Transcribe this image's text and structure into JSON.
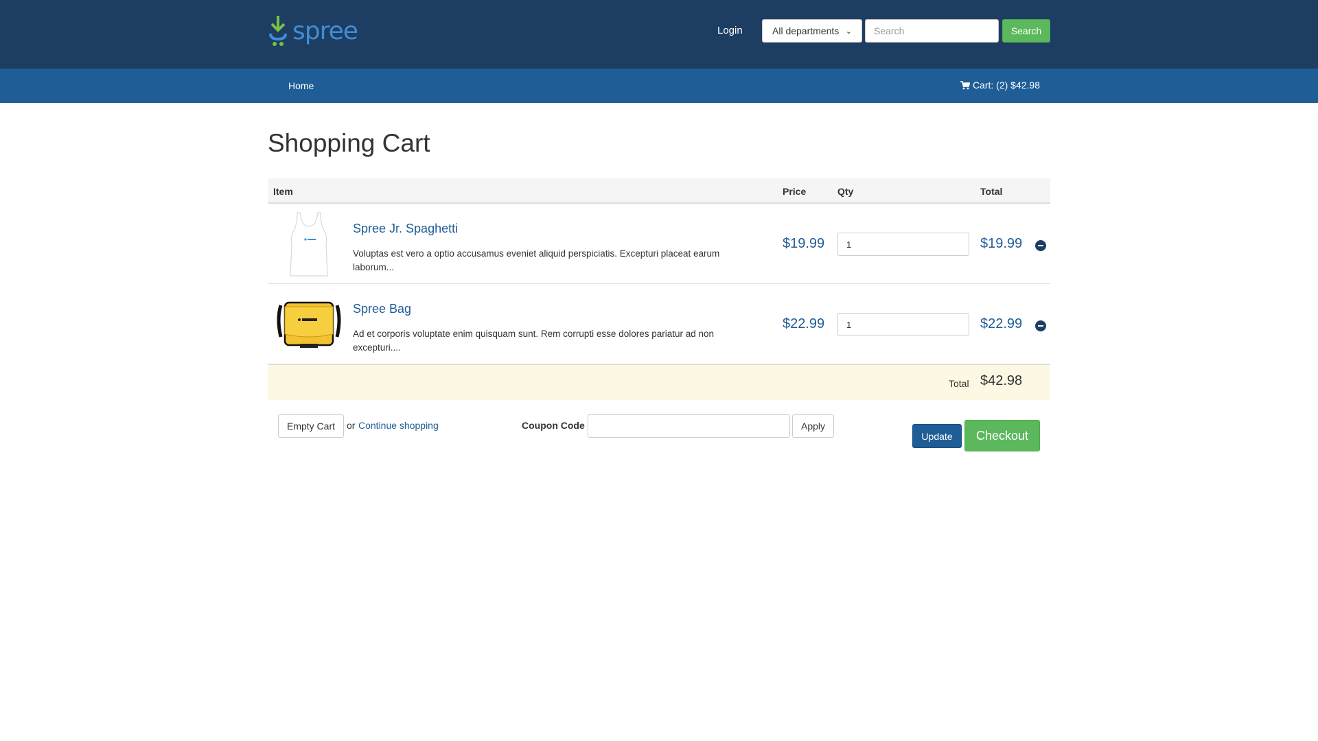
{
  "header": {
    "brand": "spree",
    "login_label": "Login",
    "department_selected": "All departments",
    "search_placeholder": "Search",
    "search_button_label": "Search"
  },
  "nav": {
    "home_label": "Home",
    "cart_label": "Cart: (2) $42.98"
  },
  "page": {
    "title": "Shopping Cart"
  },
  "cart": {
    "columns": [
      "Item",
      "Price",
      "Qty",
      "Total"
    ],
    "items": [
      {
        "name": "Spree Jr. Spaghetti",
        "description": "Voluptas est vero a optio accusamus eveniet aliquid perspiciatis. Excepturi placeat earum laborum...",
        "price": "$19.99",
        "qty": "1",
        "total": "$19.99",
        "image_icon": "tank-top-product-image"
      },
      {
        "name": "Spree Bag",
        "description": "Ad et corporis voluptate enim quisquam sunt. Rem corrupti esse dolores pariatur ad non excepturi....",
        "price": "$22.99",
        "qty": "1",
        "total": "$22.99",
        "image_icon": "messenger-bag-product-image"
      }
    ],
    "total_label": "Total",
    "total_value": "$42.98"
  },
  "actions": {
    "empty_cart_label": "Empty Cart",
    "or_text": "or",
    "continue_shopping_label": "Continue shopping",
    "coupon_label": "Coupon Code",
    "coupon_value": "",
    "apply_label": "Apply",
    "update_label": "Update",
    "checkout_label": "Checkout"
  },
  "colors": {
    "header_bg": "#1e3d63",
    "nav_bg": "#1f5d96",
    "link": "#1f5d96",
    "success": "#5cb85c",
    "total_row_bg": "#fcf8e3"
  }
}
